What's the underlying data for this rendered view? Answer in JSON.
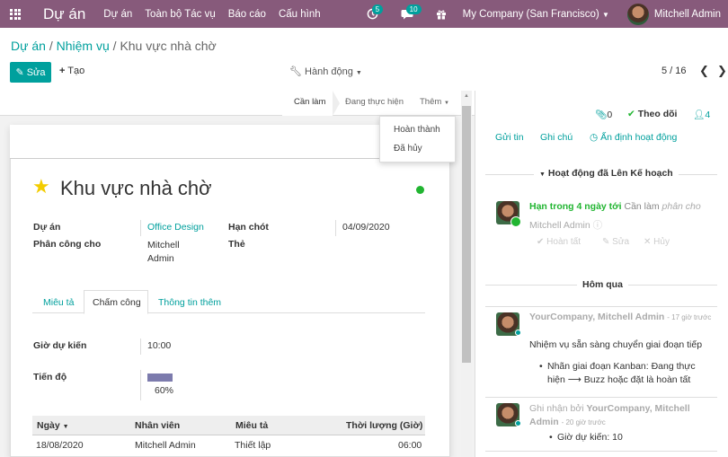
{
  "topbar": {
    "brand": "Dự án",
    "menu": [
      "Dự án",
      "Toàn bộ Tác vụ",
      "Báo cáo",
      "Cấu hình"
    ],
    "activity_count": "5",
    "message_count": "10",
    "company": "My Company (San Francisco)",
    "user": "Mitchell Admin"
  },
  "breadcrumb": {
    "root": "Dự án",
    "mid": "Nhiệm vụ",
    "current": "Khu vực nhà chờ"
  },
  "toolbar": {
    "edit": "Sửa",
    "create": "Tạo",
    "action": "Hành động",
    "pager": "5 / 16"
  },
  "statusbar": {
    "stages": [
      "Cần làm",
      "Đang thực hiện"
    ],
    "more": "Thêm",
    "dropdown": [
      "Hoàn thành",
      "Đã hủy"
    ]
  },
  "task": {
    "title": "Khu vực nhà chờ",
    "project_label": "Dự án",
    "project_value": "Office Design",
    "assigned_label": "Phân công cho",
    "assigned_line1": "Mitchell",
    "assigned_line2": "Admin",
    "deadline_label": "Hạn chót",
    "deadline_value": "04/09/2020",
    "tags_label": "Thẻ"
  },
  "tabs": [
    "Miêu tả",
    "Chấm công",
    "Thông tin thêm"
  ],
  "timesheet": {
    "planned_label": "Giờ dự kiến",
    "planned_value": "10:00",
    "progress_label": "Tiến độ",
    "progress_value": "60%",
    "progress_fraction": 0.6,
    "columns": [
      "Ngày",
      "Nhân viên",
      "Miêu tả",
      "Thời lượng (Giờ)"
    ],
    "rows": [
      {
        "date": "18/08/2020",
        "employee": "Mitchell Admin",
        "description": "Thiết lập",
        "duration": "06:00"
      }
    ]
  },
  "chatter": {
    "attachments": "0",
    "follow": "Theo dõi",
    "followers": "4",
    "send_message": "Gửi tin",
    "log_note": "Ghi chú",
    "schedule": "Ấn định hoạt động",
    "planned_title": "Hoạt động đã Lên Kế hoạch",
    "activity_due": "Hạn trong 4 ngày tới",
    "activity_summary": "Cần làm",
    "activity_type": "phân cho",
    "activity_user": "Mitchell Admin",
    "activity_done": "Hoàn tất",
    "activity_edit": "Sửa",
    "activity_cancel": "Hủy",
    "yesterday": "Hôm qua",
    "msg1_author": "YourCompany, Mitchell Admin",
    "msg1_time": "- 17 giờ trước",
    "msg1_body": "Nhiệm vụ sẵn sàng chuyển giai đoạn tiếp",
    "msg1_bullet_a": "Nhãn giai đoạn Kanban: Đang thực",
    "msg1_bullet_b": "hiện ⟶ Buzz hoặc đặt là hoàn tất",
    "msg2_prefix": "Ghi nhận bởi",
    "msg2_author": "YourCompany, Mitchell",
    "msg2_author2": "Admin",
    "msg2_time": "- 20 giờ trước",
    "msg2_bullet": "Giờ dự kiến: 10"
  }
}
